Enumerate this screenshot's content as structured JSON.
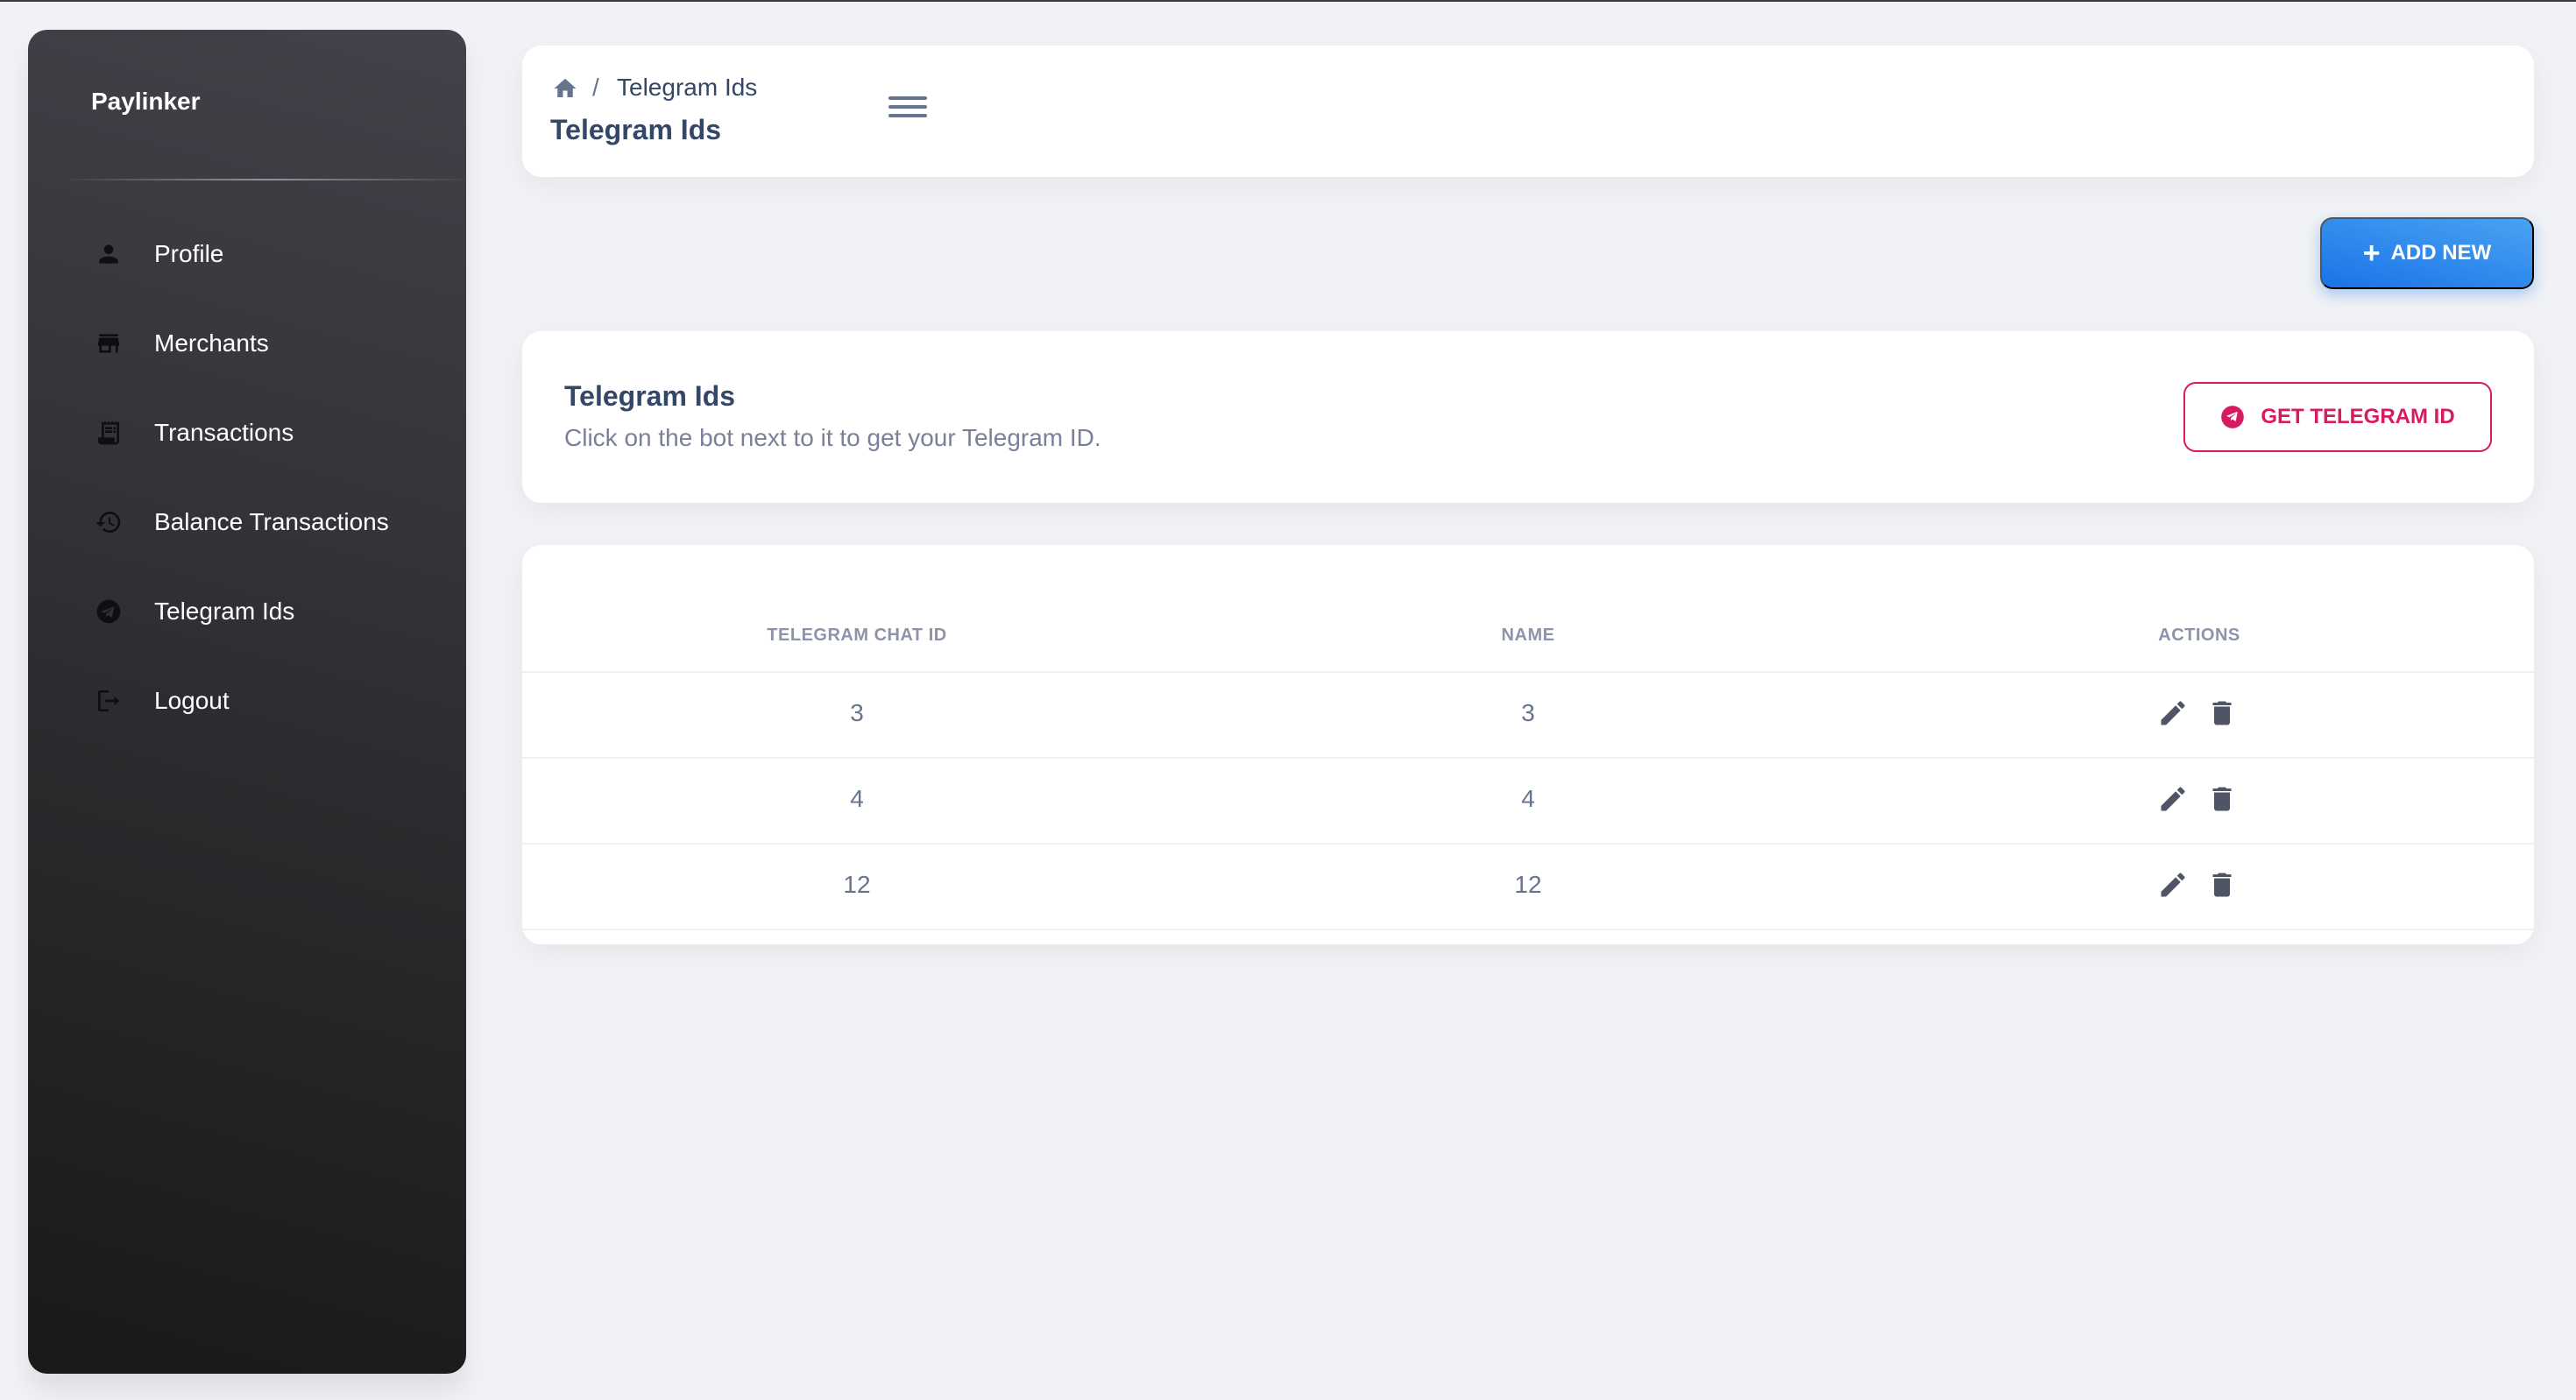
{
  "sidebar": {
    "brand": "Paylinker",
    "items": [
      {
        "label": "Profile",
        "icon": "person-icon"
      },
      {
        "label": "Merchants",
        "icon": "store-icon"
      },
      {
        "label": "Transactions",
        "icon": "receipt-icon"
      },
      {
        "label": "Balance Transactions",
        "icon": "history-icon"
      },
      {
        "label": "Telegram Ids",
        "icon": "telegram-icon"
      },
      {
        "label": "Logout",
        "icon": "logout-icon"
      }
    ]
  },
  "header": {
    "breadcrumb_separator": "/",
    "breadcrumb_current": "Telegram Ids",
    "title": "Telegram Ids"
  },
  "toolbar": {
    "add_new_label": "ADD NEW"
  },
  "info": {
    "title": "Telegram Ids",
    "subtitle": "Click on the bot next to it to get your Telegram ID.",
    "get_id_label": "GET TELEGRAM ID"
  },
  "table": {
    "columns": [
      "TELEGRAM CHAT ID",
      "NAME",
      "ACTIONS"
    ],
    "rows": [
      {
        "chat_id": "3",
        "name": "3"
      },
      {
        "chat_id": "4",
        "name": "4"
      },
      {
        "chat_id": "12",
        "name": "12"
      }
    ]
  },
  "colors": {
    "primary": "#1a73e8",
    "accent": "#d81b60",
    "sidebar_dark": "#191919"
  }
}
